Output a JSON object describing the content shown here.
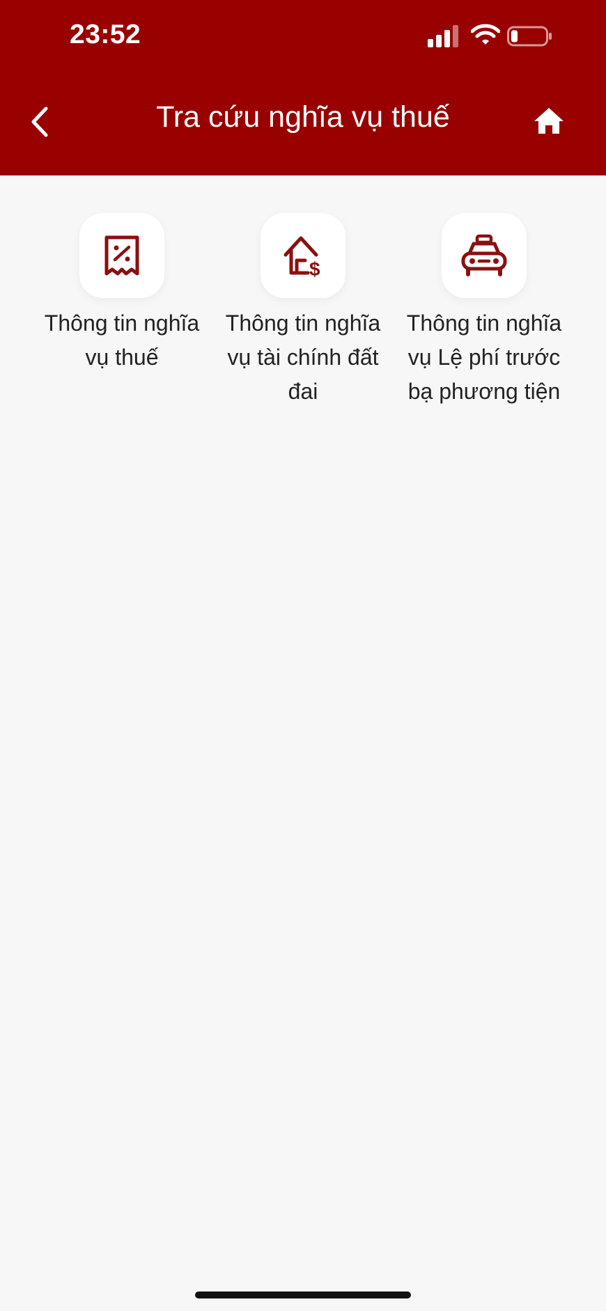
{
  "status_bar": {
    "time": "23:52",
    "icons": [
      "signal-icon",
      "wifi-icon",
      "battery-icon"
    ]
  },
  "header": {
    "title": "Tra cứu nghĩa vụ thuế",
    "back_icon": "chevron-left-icon",
    "home_icon": "home-icon"
  },
  "menu": {
    "items": [
      {
        "label": "Thông tin nghĩa vụ thuế",
        "icon": "receipt-percent-icon"
      },
      {
        "label": "Thông tin nghĩa vụ tài chính đất đai",
        "icon": "house-dollar-icon"
      },
      {
        "label": "Thông tin nghĩa vụ Lệ phí trước bạ phương tiện",
        "icon": "taxi-icon"
      }
    ]
  },
  "colors": {
    "brand": "#990000",
    "background": "#f7f7f7",
    "icon": "#8b1010",
    "text": "#222222"
  }
}
